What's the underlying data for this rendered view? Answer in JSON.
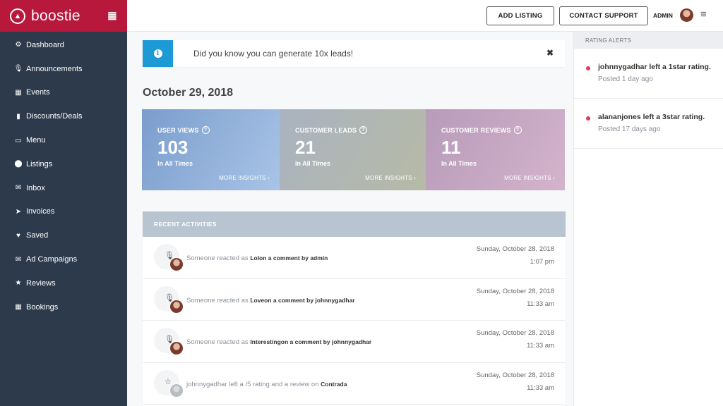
{
  "brand": {
    "name": "boostie"
  },
  "sidebar": {
    "items": [
      {
        "label": "Dashboard",
        "icon": "dashboard-icon",
        "glyph": "⚙"
      },
      {
        "label": "Announcements",
        "icon": "microphone-icon",
        "glyph": "🎙"
      },
      {
        "label": "Events",
        "icon": "calendar-icon",
        "glyph": "▦"
      },
      {
        "label": "Discounts/Deals",
        "icon": "bar-chart-icon",
        "glyph": "▮"
      },
      {
        "label": "Menu",
        "icon": "card-icon",
        "glyph": "▭"
      },
      {
        "label": "Listings",
        "icon": "map-pin-icon",
        "glyph": "⬤"
      },
      {
        "label": "Inbox",
        "icon": "envelope-icon",
        "glyph": "✉"
      },
      {
        "label": "Invoices",
        "icon": "paper-plane-icon",
        "glyph": "➤"
      },
      {
        "label": "Saved",
        "icon": "heart-icon",
        "glyph": "♥"
      },
      {
        "label": "Ad Campaigns",
        "icon": "envelope-icon",
        "glyph": "✉"
      },
      {
        "label": "Reviews",
        "icon": "star-icon",
        "glyph": "★"
      },
      {
        "label": "Bookings",
        "icon": "calendar-icon",
        "glyph": "▦"
      }
    ]
  },
  "topbar": {
    "add_listing": "ADD LISTING",
    "contact_support": "CONTACT SUPPORT",
    "admin": "ADMIN"
  },
  "notice": {
    "text": "Did you know you can generate 10x leads!",
    "close": "✖"
  },
  "main": {
    "date": "October 29, 2018",
    "stats": [
      {
        "label": "USER VIEWS",
        "value": "103",
        "sub": "In All Times",
        "more": "MORE INSIGHTS ›"
      },
      {
        "label": "CUSTOMER LEADS",
        "value": "21",
        "sub": "In All Times",
        "more": "MORE INSIGHTS ›"
      },
      {
        "label": "CUSTOMER REVIEWS",
        "value": "11",
        "sub": "In All Times",
        "more": "MORE INSIGHTS ›"
      }
    ],
    "activities": {
      "title": "RECENT ACTIVITIES",
      "rows": [
        {
          "prefix": "Someone reacted as ",
          "bold": "Lolon a comment by admin",
          "date": "Sunday, October 28, 2018",
          "time": "1:07 pm",
          "icon": "microphone-icon",
          "glyph": "🎙"
        },
        {
          "prefix": "Someone reacted as ",
          "bold": "Loveon a comment by johnnygadhar",
          "date": "Sunday, October 28, 2018",
          "time": "11:33 am",
          "icon": "microphone-icon",
          "glyph": "🎙"
        },
        {
          "prefix": "Someone reacted as ",
          "bold": "Interestingon a comment by johnnygadhar",
          "date": "Sunday, October 28, 2018",
          "time": "11:33 am",
          "icon": "microphone-icon",
          "glyph": "🎙"
        },
        {
          "prefix": "johnnygadhar left a /5 rating and a review on ",
          "bold": "Contrada",
          "date": "Sunday, October 28, 2018",
          "time": "11:33 am",
          "icon": "star-outline-icon",
          "glyph": "☆"
        }
      ]
    }
  },
  "rating_alerts": {
    "title": "RATING ALERTS",
    "items": [
      {
        "text": "johnnygadhar left a 1star rating.",
        "time": "Posted 1 day ago"
      },
      {
        "text": "alananjones left a 3star rating.",
        "time": "Posted 17 days ago"
      }
    ]
  }
}
